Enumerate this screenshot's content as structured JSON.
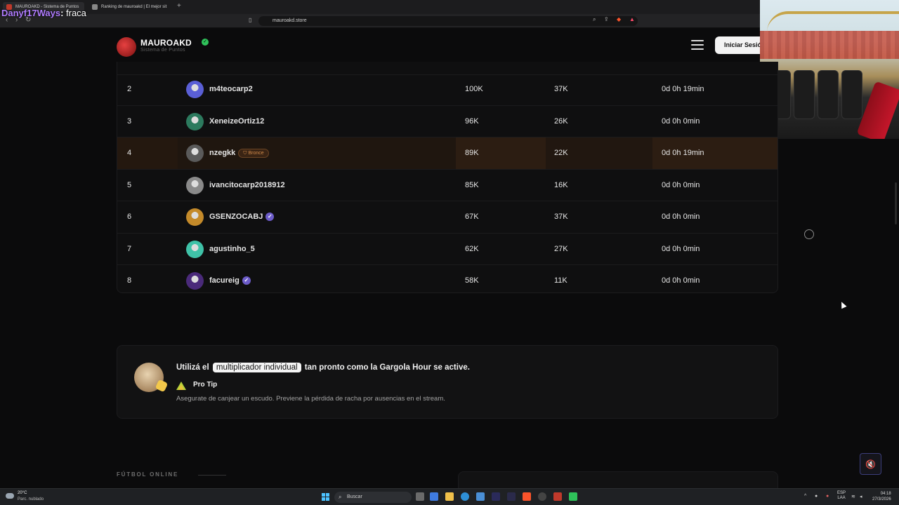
{
  "browser": {
    "tabs": [
      {
        "title": "MAUROAKD - Sistema de Puntos",
        "active": true
      },
      {
        "title": "Ranking de mauroakd | El mejor sit",
        "active": false
      }
    ],
    "new_tab": "+",
    "url": "mauroakd.store"
  },
  "chat_overlay": {
    "username": "Danyf17Ways",
    "message": "fraca"
  },
  "site": {
    "brand": "MAUROAKD",
    "brand_subtitle": "Sistema de Puntos",
    "login_label": "Iniciar Sesión"
  },
  "leaderboard": {
    "rows": [
      {
        "rank": "2",
        "name": "m4teocarp2",
        "points": "100K",
        "secondary": "37K",
        "time": "0d 0h 19min",
        "verified": false,
        "tier": "",
        "avatar_color": "#5a5fd6"
      },
      {
        "rank": "3",
        "name": "XeneizeOrtiz12",
        "points": "96K",
        "secondary": "26K",
        "time": "0d 0h 0min",
        "verified": false,
        "tier": "",
        "avatar_color": "#2c7a5e"
      },
      {
        "rank": "4",
        "name": "nzegkk",
        "points": "89K",
        "secondary": "22K",
        "time": "0d 0h 19min",
        "verified": false,
        "tier": "Bronce",
        "avatar_color": "#5a5a5a",
        "highlight": true
      },
      {
        "rank": "5",
        "name": "ivancitocarp2018912",
        "points": "85K",
        "secondary": "16K",
        "time": "0d 0h 0min",
        "verified": false,
        "tier": "",
        "avatar_color": "#8a8a8a"
      },
      {
        "rank": "6",
        "name": "GSENZOCABJ",
        "points": "67K",
        "secondary": "37K",
        "time": "0d 0h 0min",
        "verified": true,
        "tier": "",
        "avatar_color": "#c48a2a"
      },
      {
        "rank": "7",
        "name": "agustinho_5",
        "points": "62K",
        "secondary": "27K",
        "time": "0d 0h 0min",
        "verified": false,
        "tier": "",
        "avatar_color": "#3fc2a8"
      },
      {
        "rank": "8",
        "name": "facureig",
        "points": "58K",
        "secondary": "11K",
        "time": "0d 0h 0min",
        "verified": true,
        "tier": "",
        "avatar_color": "#4a2a7a"
      }
    ]
  },
  "tip": {
    "prefix": "Utilizá el",
    "pill": "multiplicador individual",
    "suffix": "tan pronto como la Gargola Hour se active.",
    "label": "Pro Tip",
    "description": "Asegurate de canjear un escudo. Previene la pérdida de racha por ausencias en el stream."
  },
  "section": {
    "label": "FÚTBOL ONLINE"
  },
  "taskbar": {
    "weather_temp": "20°C",
    "weather_desc": "Parc. nublado",
    "search_placeholder": "Buscar",
    "lang_line1": "ESP",
    "lang_line2": "LAA",
    "time": "04:18",
    "date": "27/3/2026"
  },
  "colors": {
    "accent_bronze": "#d08a4a",
    "verified_badge": "#6c5cc9",
    "brand_verified": "#2fc25a"
  },
  "icons": [
    "back-icon",
    "forward-icon",
    "reload-icon",
    "bookmark-icon",
    "zoom-icon",
    "share-icon",
    "brave-shield-icon",
    "menu-icon",
    "verified-icon",
    "sound-icon",
    "windows-icon",
    "search-icon"
  ]
}
